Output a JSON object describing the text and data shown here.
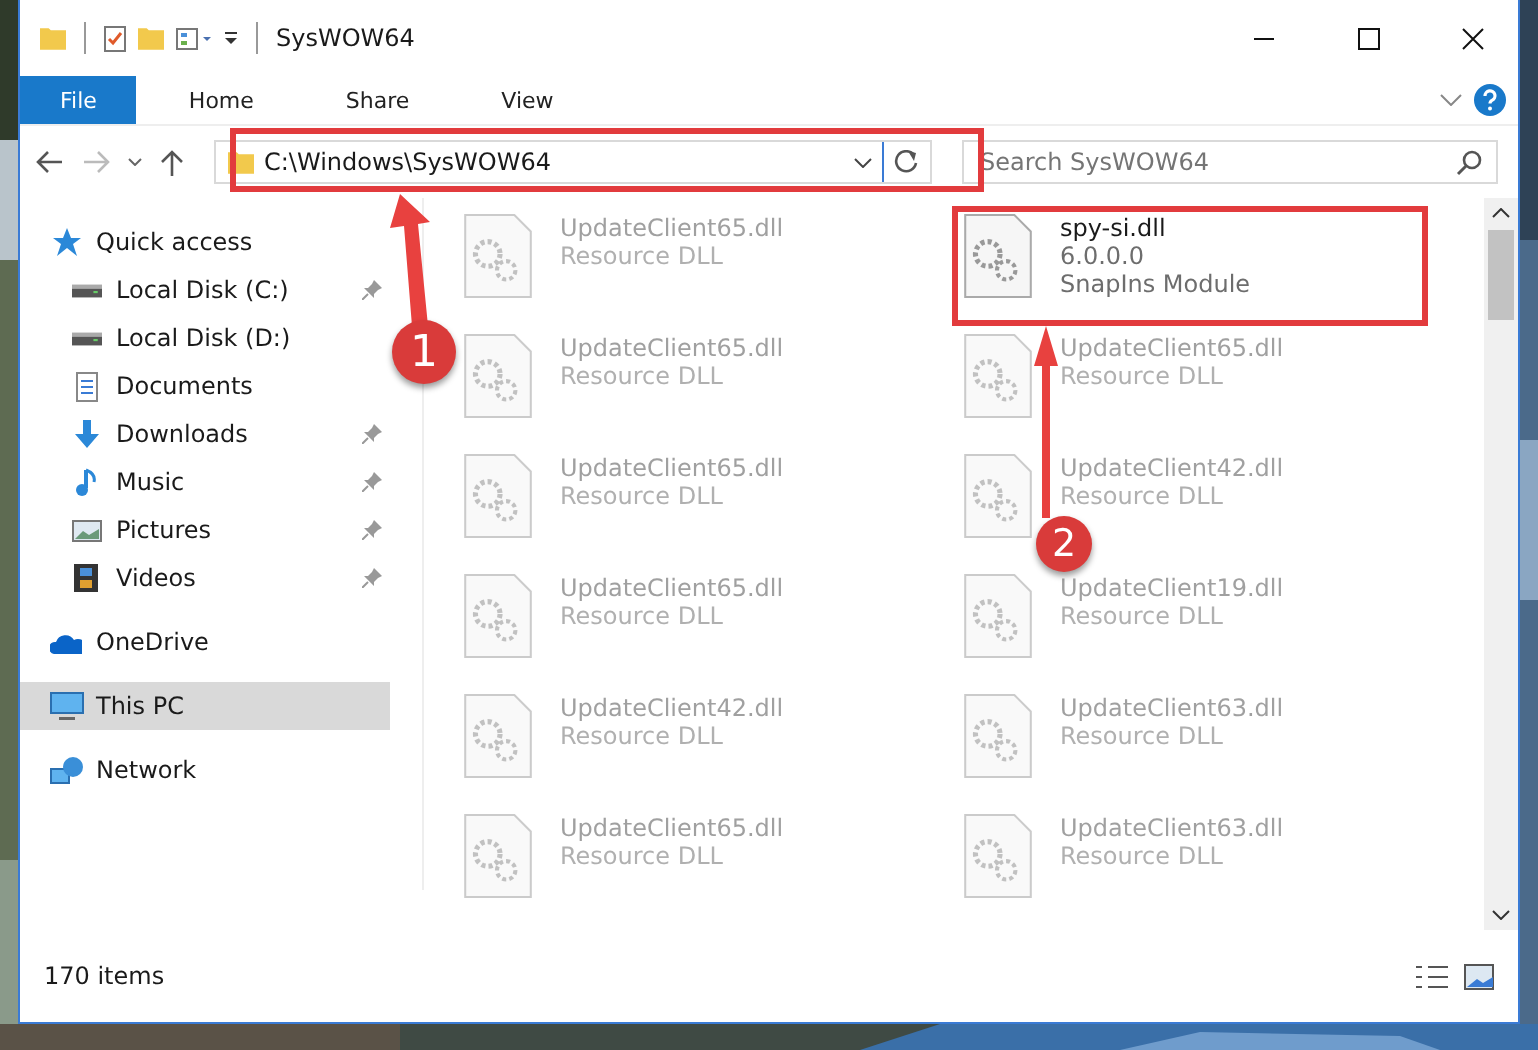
{
  "window": {
    "title": "SysWOW64"
  },
  "ribbon_tabs": [
    {
      "label": "File",
      "selected": true
    },
    {
      "label": "Home",
      "selected": false
    },
    {
      "label": "Share",
      "selected": false
    },
    {
      "label": "View",
      "selected": false
    }
  ],
  "address": {
    "value": "C:\\Windows\\SysWOW64"
  },
  "search": {
    "placeholder": "Search SysWOW64"
  },
  "sidebar": {
    "items": [
      {
        "label": "Quick access",
        "selected": false,
        "children": [
          {
            "label": "Local Disk (C:)",
            "pinned": true,
            "selected": false
          },
          {
            "label": "Local Disk (D:)",
            "pinned": false,
            "selected": false
          },
          {
            "label": "Documents",
            "pinned": false,
            "selected": false
          },
          {
            "label": "Downloads",
            "pinned": true,
            "selected": false
          },
          {
            "label": "Music",
            "pinned": true,
            "selected": false
          },
          {
            "label": "Pictures",
            "pinned": true,
            "selected": false
          },
          {
            "label": "Videos",
            "pinned": true,
            "selected": false
          }
        ]
      },
      {
        "label": "OneDrive",
        "selected": false
      },
      {
        "label": "This PC",
        "selected": true
      },
      {
        "label": "Network",
        "selected": false
      }
    ]
  },
  "files": [
    {
      "name": "UpdateClient65.dll",
      "lines": [
        "Resource DLL"
      ],
      "faded": true
    },
    {
      "name": "spy-si.dll",
      "lines": [
        "6.0.0.0",
        "SnapIns Module"
      ],
      "faded": false
    },
    {
      "name": "UpdateClient65.dll",
      "lines": [
        "Resource DLL"
      ],
      "faded": true
    },
    {
      "name": "UpdateClient65.dll",
      "lines": [
        "Resource DLL"
      ],
      "faded": true
    },
    {
      "name": "UpdateClient65.dll",
      "lines": [
        "Resource DLL"
      ],
      "faded": true
    },
    {
      "name": "UpdateClient42.dll",
      "lines": [
        "Resource DLL"
      ],
      "faded": true
    },
    {
      "name": "UpdateClient65.dll",
      "lines": [
        "Resource DLL"
      ],
      "faded": true
    },
    {
      "name": "UpdateClient19.dll",
      "lines": [
        "Resource DLL"
      ],
      "faded": true
    },
    {
      "name": "UpdateClient42.dll",
      "lines": [
        "Resource DLL"
      ],
      "faded": true
    },
    {
      "name": "UpdateClient63.dll",
      "lines": [
        "Resource DLL"
      ],
      "faded": true
    },
    {
      "name": "UpdateClient65.dll",
      "lines": [
        "Resource DLL"
      ],
      "faded": true
    },
    {
      "name": "UpdateClient63.dll",
      "lines": [
        "Resource DLL"
      ],
      "faded": true
    }
  ],
  "status_bar": {
    "item_count": "170 items"
  },
  "annotations": [
    {
      "label": "1"
    },
    {
      "label": "2"
    }
  ]
}
